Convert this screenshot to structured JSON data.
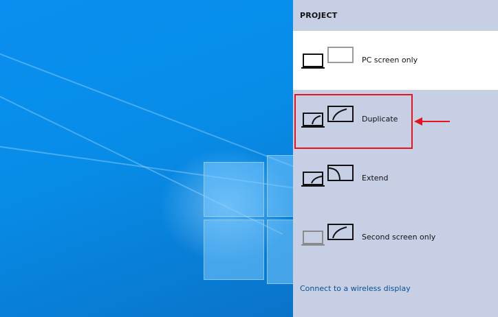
{
  "panel": {
    "title": "PROJECT",
    "options": [
      {
        "label": "PC screen only",
        "icon": "pc-screen-only-icon",
        "selected": true
      },
      {
        "label": "Duplicate",
        "icon": "duplicate-icon",
        "selected": false
      },
      {
        "label": "Extend",
        "icon": "extend-icon",
        "selected": false
      },
      {
        "label": "Second screen only",
        "icon": "second-screen-only-icon",
        "selected": false
      }
    ],
    "wireless_link": "Connect to a wireless display"
  },
  "colors": {
    "panel_bg": "#c6cfe3",
    "selected_bg": "#ffffff",
    "highlight": "#e8121c",
    "link": "#0b4f93",
    "desktop": "#078de8"
  }
}
